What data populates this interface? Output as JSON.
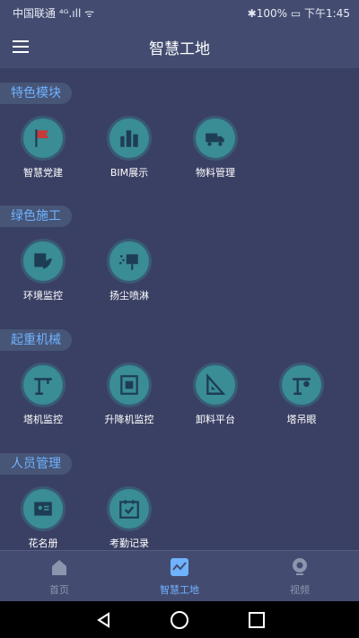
{
  "status": {
    "carrier": "中国联通 ⁴ᴳ.ıll ᯤ",
    "battery": "✱100%",
    "time": "下午1:45"
  },
  "header": {
    "title": "智慧工地"
  },
  "sections": [
    {
      "label": "特色模块",
      "items": [
        {
          "label": "智慧党建"
        },
        {
          "label": "BIM展示"
        },
        {
          "label": "物料管理"
        }
      ]
    },
    {
      "label": "绿色施工",
      "items": [
        {
          "label": "环境监控"
        },
        {
          "label": "扬尘喷淋"
        }
      ]
    },
    {
      "label": "起重机械",
      "items": [
        {
          "label": "塔机监控"
        },
        {
          "label": "升降机监控"
        },
        {
          "label": "卸料平台"
        },
        {
          "label": "塔吊眼"
        }
      ]
    },
    {
      "label": "人员管理",
      "items": [
        {
          "label": "花名册"
        },
        {
          "label": "考勤记录"
        }
      ]
    }
  ],
  "nav": [
    {
      "label": "首页"
    },
    {
      "label": "智慧工地"
    },
    {
      "label": "视频"
    }
  ],
  "colors": {
    "accent": "#6fb2ff",
    "bg": "#3a4064",
    "bar": "#434c70",
    "tile": "#3a8c95"
  }
}
